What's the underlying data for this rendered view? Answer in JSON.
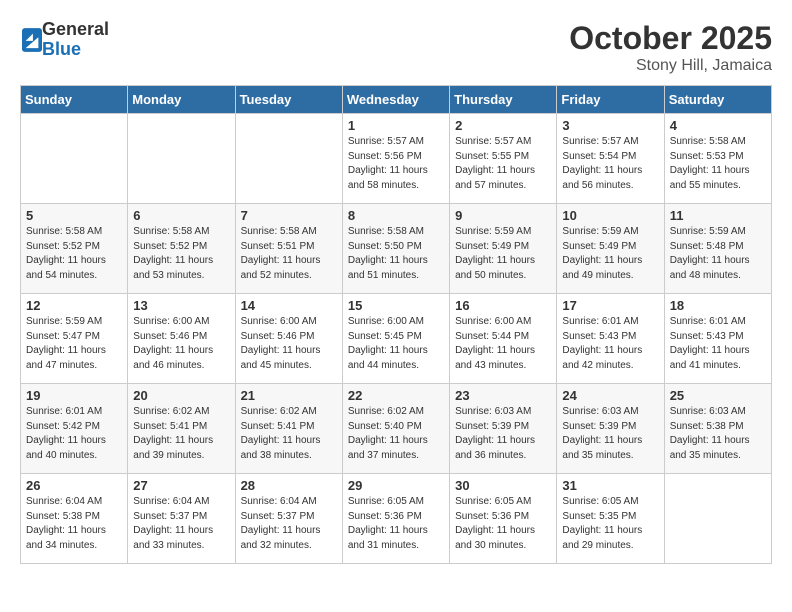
{
  "header": {
    "logo_general": "General",
    "logo_blue": "Blue",
    "month": "October 2025",
    "location": "Stony Hill, Jamaica"
  },
  "days_of_week": [
    "Sunday",
    "Monday",
    "Tuesday",
    "Wednesday",
    "Thursday",
    "Friday",
    "Saturday"
  ],
  "weeks": [
    [
      {
        "day": "",
        "info": ""
      },
      {
        "day": "",
        "info": ""
      },
      {
        "day": "",
        "info": ""
      },
      {
        "day": "1",
        "info": "Sunrise: 5:57 AM\nSunset: 5:56 PM\nDaylight: 11 hours\nand 58 minutes."
      },
      {
        "day": "2",
        "info": "Sunrise: 5:57 AM\nSunset: 5:55 PM\nDaylight: 11 hours\nand 57 minutes."
      },
      {
        "day": "3",
        "info": "Sunrise: 5:57 AM\nSunset: 5:54 PM\nDaylight: 11 hours\nand 56 minutes."
      },
      {
        "day": "4",
        "info": "Sunrise: 5:58 AM\nSunset: 5:53 PM\nDaylight: 11 hours\nand 55 minutes."
      }
    ],
    [
      {
        "day": "5",
        "info": "Sunrise: 5:58 AM\nSunset: 5:52 PM\nDaylight: 11 hours\nand 54 minutes."
      },
      {
        "day": "6",
        "info": "Sunrise: 5:58 AM\nSunset: 5:52 PM\nDaylight: 11 hours\nand 53 minutes."
      },
      {
        "day": "7",
        "info": "Sunrise: 5:58 AM\nSunset: 5:51 PM\nDaylight: 11 hours\nand 52 minutes."
      },
      {
        "day": "8",
        "info": "Sunrise: 5:58 AM\nSunset: 5:50 PM\nDaylight: 11 hours\nand 51 minutes."
      },
      {
        "day": "9",
        "info": "Sunrise: 5:59 AM\nSunset: 5:49 PM\nDaylight: 11 hours\nand 50 minutes."
      },
      {
        "day": "10",
        "info": "Sunrise: 5:59 AM\nSunset: 5:49 PM\nDaylight: 11 hours\nand 49 minutes."
      },
      {
        "day": "11",
        "info": "Sunrise: 5:59 AM\nSunset: 5:48 PM\nDaylight: 11 hours\nand 48 minutes."
      }
    ],
    [
      {
        "day": "12",
        "info": "Sunrise: 5:59 AM\nSunset: 5:47 PM\nDaylight: 11 hours\nand 47 minutes."
      },
      {
        "day": "13",
        "info": "Sunrise: 6:00 AM\nSunset: 5:46 PM\nDaylight: 11 hours\nand 46 minutes."
      },
      {
        "day": "14",
        "info": "Sunrise: 6:00 AM\nSunset: 5:46 PM\nDaylight: 11 hours\nand 45 minutes."
      },
      {
        "day": "15",
        "info": "Sunrise: 6:00 AM\nSunset: 5:45 PM\nDaylight: 11 hours\nand 44 minutes."
      },
      {
        "day": "16",
        "info": "Sunrise: 6:00 AM\nSunset: 5:44 PM\nDaylight: 11 hours\nand 43 minutes."
      },
      {
        "day": "17",
        "info": "Sunrise: 6:01 AM\nSunset: 5:43 PM\nDaylight: 11 hours\nand 42 minutes."
      },
      {
        "day": "18",
        "info": "Sunrise: 6:01 AM\nSunset: 5:43 PM\nDaylight: 11 hours\nand 41 minutes."
      }
    ],
    [
      {
        "day": "19",
        "info": "Sunrise: 6:01 AM\nSunset: 5:42 PM\nDaylight: 11 hours\nand 40 minutes."
      },
      {
        "day": "20",
        "info": "Sunrise: 6:02 AM\nSunset: 5:41 PM\nDaylight: 11 hours\nand 39 minutes."
      },
      {
        "day": "21",
        "info": "Sunrise: 6:02 AM\nSunset: 5:41 PM\nDaylight: 11 hours\nand 38 minutes."
      },
      {
        "day": "22",
        "info": "Sunrise: 6:02 AM\nSunset: 5:40 PM\nDaylight: 11 hours\nand 37 minutes."
      },
      {
        "day": "23",
        "info": "Sunrise: 6:03 AM\nSunset: 5:39 PM\nDaylight: 11 hours\nand 36 minutes."
      },
      {
        "day": "24",
        "info": "Sunrise: 6:03 AM\nSunset: 5:39 PM\nDaylight: 11 hours\nand 35 minutes."
      },
      {
        "day": "25",
        "info": "Sunrise: 6:03 AM\nSunset: 5:38 PM\nDaylight: 11 hours\nand 35 minutes."
      }
    ],
    [
      {
        "day": "26",
        "info": "Sunrise: 6:04 AM\nSunset: 5:38 PM\nDaylight: 11 hours\nand 34 minutes."
      },
      {
        "day": "27",
        "info": "Sunrise: 6:04 AM\nSunset: 5:37 PM\nDaylight: 11 hours\nand 33 minutes."
      },
      {
        "day": "28",
        "info": "Sunrise: 6:04 AM\nSunset: 5:37 PM\nDaylight: 11 hours\nand 32 minutes."
      },
      {
        "day": "29",
        "info": "Sunrise: 6:05 AM\nSunset: 5:36 PM\nDaylight: 11 hours\nand 31 minutes."
      },
      {
        "day": "30",
        "info": "Sunrise: 6:05 AM\nSunset: 5:36 PM\nDaylight: 11 hours\nand 30 minutes."
      },
      {
        "day": "31",
        "info": "Sunrise: 6:05 AM\nSunset: 5:35 PM\nDaylight: 11 hours\nand 29 minutes."
      },
      {
        "day": "",
        "info": ""
      }
    ]
  ]
}
